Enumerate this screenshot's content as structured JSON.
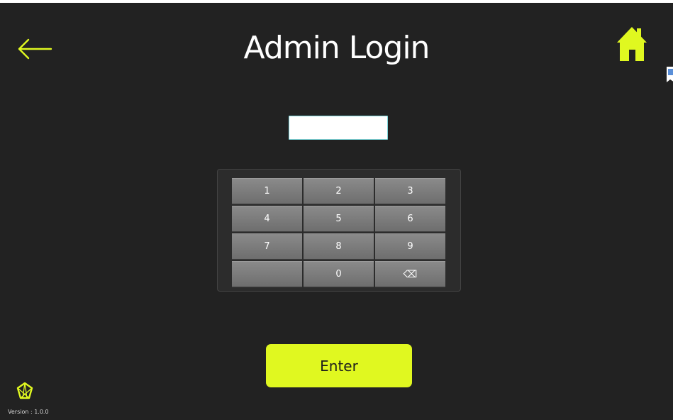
{
  "app": {
    "title": "Admin Login",
    "version": "Version : 1.0.0"
  },
  "icons": {
    "back": "arrow-left-icon",
    "home": "home-icon",
    "logo": "app-logo-icon",
    "backspace": "backspace-icon"
  },
  "colors": {
    "accent": "#e0f820",
    "background": "#222222",
    "key_face": "#7c7c7c",
    "text": "#ffffff"
  },
  "login": {
    "pin_value": "",
    "pin_placeholder": ""
  },
  "keypad": {
    "keys": [
      "1",
      "2",
      "3",
      "4",
      "5",
      "6",
      "7",
      "8",
      "9",
      "",
      "0",
      "⌫"
    ]
  },
  "actions": {
    "enter_label": "Enter"
  }
}
